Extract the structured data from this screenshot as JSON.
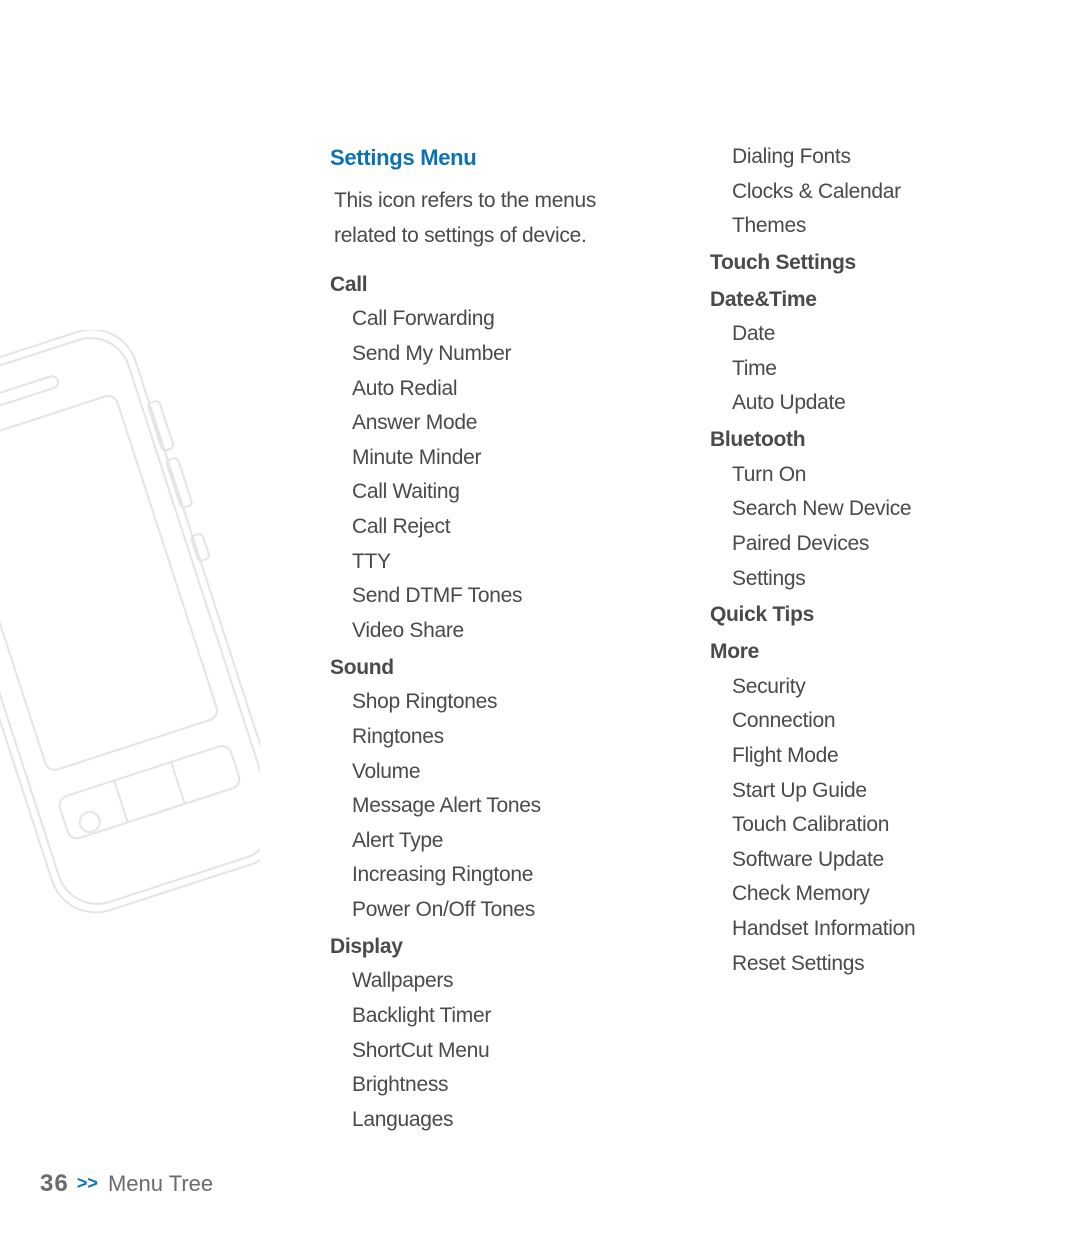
{
  "page": {
    "number": "36",
    "chevron": ">>",
    "section": "Menu Tree"
  },
  "heading": "Settings Menu",
  "intro": "This icon refers to the menus related to settings of device.",
  "col1": [
    {
      "type": "cat",
      "text": "Call"
    },
    {
      "type": "item",
      "text": "Call Forwarding"
    },
    {
      "type": "item",
      "text": "Send My Number"
    },
    {
      "type": "item",
      "text": "Auto Redial"
    },
    {
      "type": "item",
      "text": "Answer Mode"
    },
    {
      "type": "item",
      "text": "Minute Minder"
    },
    {
      "type": "item",
      "text": "Call Waiting"
    },
    {
      "type": "item",
      "text": "Call Reject"
    },
    {
      "type": "item",
      "text": "TTY"
    },
    {
      "type": "item",
      "text": "Send DTMF Tones"
    },
    {
      "type": "item",
      "text": "Video Share"
    },
    {
      "type": "cat",
      "text": "Sound"
    },
    {
      "type": "item",
      "text": "Shop Ringtones"
    },
    {
      "type": "item",
      "text": "Ringtones"
    },
    {
      "type": "item",
      "text": "Volume"
    },
    {
      "type": "item",
      "text": "Message Alert Tones"
    },
    {
      "type": "item",
      "text": "Alert Type"
    },
    {
      "type": "item",
      "text": "Increasing Ringtone"
    },
    {
      "type": "item",
      "text": "Power On/Off Tones"
    },
    {
      "type": "cat",
      "text": "Display"
    },
    {
      "type": "item",
      "text": "Wallpapers"
    },
    {
      "type": "item",
      "text": "Backlight Timer"
    },
    {
      "type": "item",
      "text": "ShortCut Menu"
    },
    {
      "type": "item",
      "text": "Brightness"
    },
    {
      "type": "item",
      "text": "Languages"
    }
  ],
  "col2": [
    {
      "type": "item",
      "text": "Dialing Fonts"
    },
    {
      "type": "item",
      "text": "Clocks & Calendar"
    },
    {
      "type": "item",
      "text": "Themes"
    },
    {
      "type": "cat",
      "text": "Touch Settings"
    },
    {
      "type": "cat",
      "text": "Date&Time"
    },
    {
      "type": "item",
      "text": "Date"
    },
    {
      "type": "item",
      "text": "Time"
    },
    {
      "type": "item",
      "text": "Auto Update"
    },
    {
      "type": "cat",
      "text": "Bluetooth"
    },
    {
      "type": "item",
      "text": "Turn On"
    },
    {
      "type": "item",
      "text": "Search New Device"
    },
    {
      "type": "item",
      "text": "Paired Devices"
    },
    {
      "type": "item",
      "text": "Settings"
    },
    {
      "type": "cat",
      "text": "Quick Tips"
    },
    {
      "type": "cat",
      "text": "More"
    },
    {
      "type": "item",
      "text": "Security"
    },
    {
      "type": "item",
      "text": "Connection"
    },
    {
      "type": "item",
      "text": "Flight Mode"
    },
    {
      "type": "item",
      "text": "Start Up Guide"
    },
    {
      "type": "item",
      "text": "Touch Calibration"
    },
    {
      "type": "item",
      "text": "Software Update"
    },
    {
      "type": "item",
      "text": "Check Memory"
    },
    {
      "type": "item",
      "text": "Handset Information"
    },
    {
      "type": "item",
      "text": "Reset Settings"
    }
  ]
}
